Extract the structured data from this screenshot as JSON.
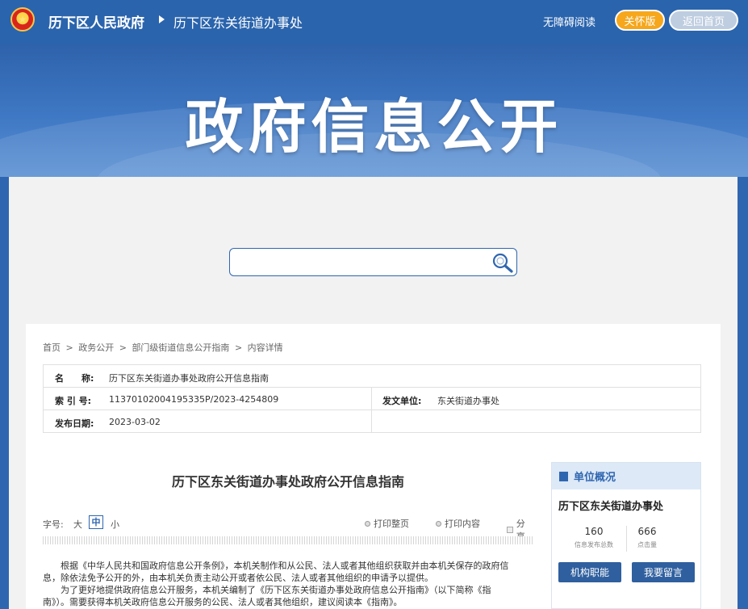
{
  "header": {
    "emblem_label": "徽",
    "site_name": "历下区人民政府",
    "sub_site": "历下区东关街道办事处",
    "accessible_reading": "无障碍阅读",
    "care_mode": "关怀版",
    "back_home": "返回首页"
  },
  "banner": {
    "title": "政府信息公开"
  },
  "search": {
    "placeholder": "",
    "value": ""
  },
  "breadcrumb": [
    "首页",
    ">",
    "政务公开",
    ">",
    "部门级街道信息公开指南",
    ">",
    "内容详情"
  ],
  "meta": {
    "name_label": "名　　称:",
    "name_value": "历下区东关街道办事处政府公开信息指南",
    "index_label": "索 引 号:",
    "index_value": "11370102004195335P/2023-4254809",
    "issuer_label": "发文单位:",
    "issuer_value": "东关街道办事处",
    "date_label": "发布日期:",
    "date_value": "2023-03-02"
  },
  "article": {
    "title": "历下区东关街道办事处政府公开信息指南",
    "font_size_label": "字号:",
    "font_big": "大",
    "font_mid": "中",
    "font_small": "小",
    "print_page": "打印整页",
    "print_content": "打印内容",
    "share": "分享",
    "para1_line1": "　　根据《中华人民共和国政府信息公开条例》，本机关制作和从公民、法人或者其他组织获取并由本机关保存的政府信",
    "para1_line2": "息，除依法免予公开的外，由本机关负责主动公开或者依公民、法人或者其他组织的申请予以提供。",
    "para2_line1": "　　为了更好地提供政府信息公开服务，本机关编制了《历下区东关街道办事处政府信息公开指南》（以下简称《指",
    "para2_line2": "南》）。需要获得本机关政府信息公开服务的公民、法人或者其他组织，建议阅读本《指南》。"
  },
  "sidebar": {
    "title": "单位概况",
    "org_name": "历下区东关街道办事处",
    "stat1_num": "160",
    "stat1_label": "信息发布总数",
    "stat2_num": "666",
    "stat2_label": "点击量",
    "btn_functions": "机构职能",
    "btn_message": "我要留言"
  },
  "colors": {
    "brand_blue": "#2f66b0",
    "care_orange": "#f6a71c"
  }
}
